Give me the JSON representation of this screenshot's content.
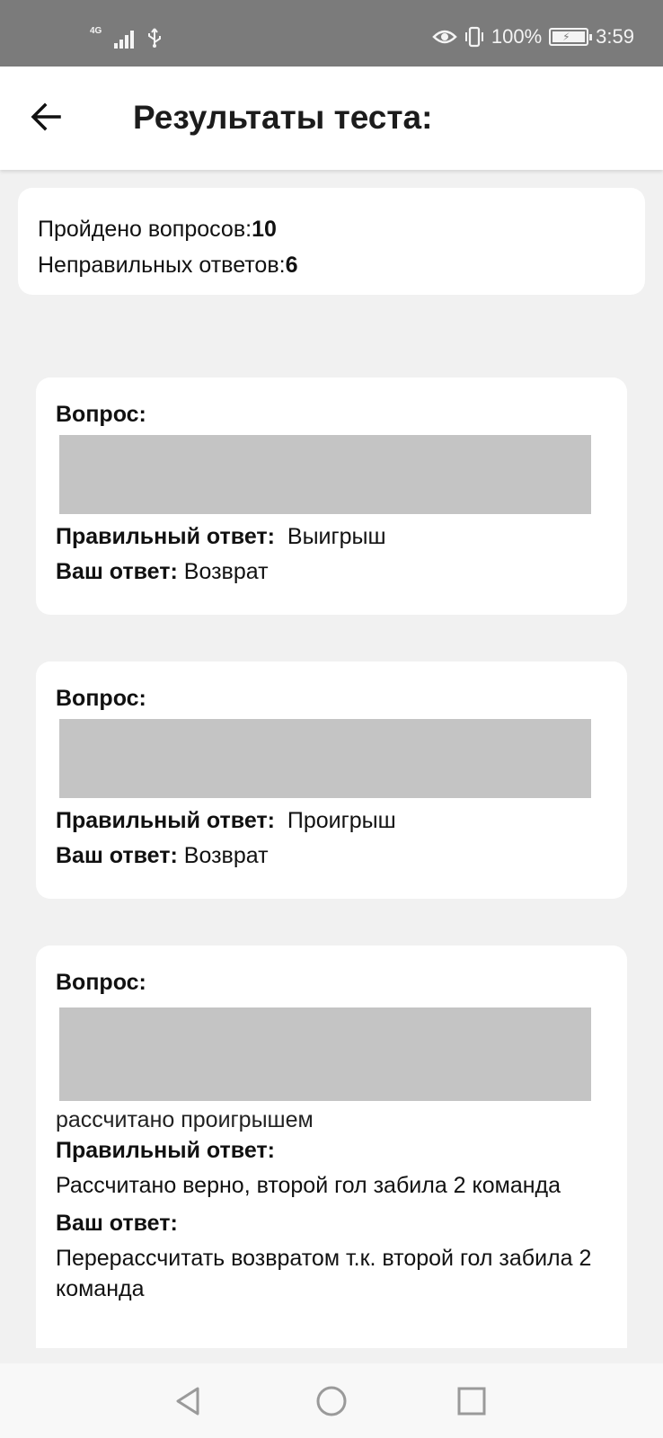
{
  "status_bar": {
    "network": "4G",
    "battery_percent": "100%",
    "battery_level": 1.0,
    "time": "3:59",
    "icons": [
      "signal-icon",
      "usb-icon",
      "eye-icon",
      "vibrate-icon",
      "battery-charging-icon"
    ]
  },
  "app_bar": {
    "title": "Результаты теста:",
    "back_icon": "arrow-left-icon"
  },
  "summary": {
    "passed_label": "Пройдено вопросов:",
    "passed_value": "10",
    "wrong_label": "Неправильных ответов:",
    "wrong_value": "6"
  },
  "results": [
    {
      "question_label": "Вопрос:",
      "correct_label": "Правильный ответ:",
      "correct_value": "Выигрыш",
      "your_label": "Ваш ответ:",
      "your_value": "Возврат"
    },
    {
      "question_label": "Вопрос:",
      "correct_label": "Правильный ответ:",
      "correct_value": "Проигрыш",
      "your_label": "Ваш ответ:",
      "your_value": "Возврат"
    },
    {
      "question_label": "Вопрос:",
      "question_tail": "рассчитано проигрышем",
      "correct_label": "Правильный ответ:",
      "correct_value": "Рассчитано верно, второй гол забила 2 команда",
      "your_label": "Ваш ответ:",
      "your_value": "Перерассчитать возвратом т.к. второй гол забила 2 команда"
    }
  ],
  "nav_bar": {
    "icons": [
      "back-triangle-icon",
      "home-circle-icon",
      "recents-square-icon"
    ]
  },
  "colors": {
    "status_bar": "#7b7b7b",
    "background": "#f1f1f1",
    "card": "#ffffff",
    "redaction": "#c4c4c4"
  }
}
